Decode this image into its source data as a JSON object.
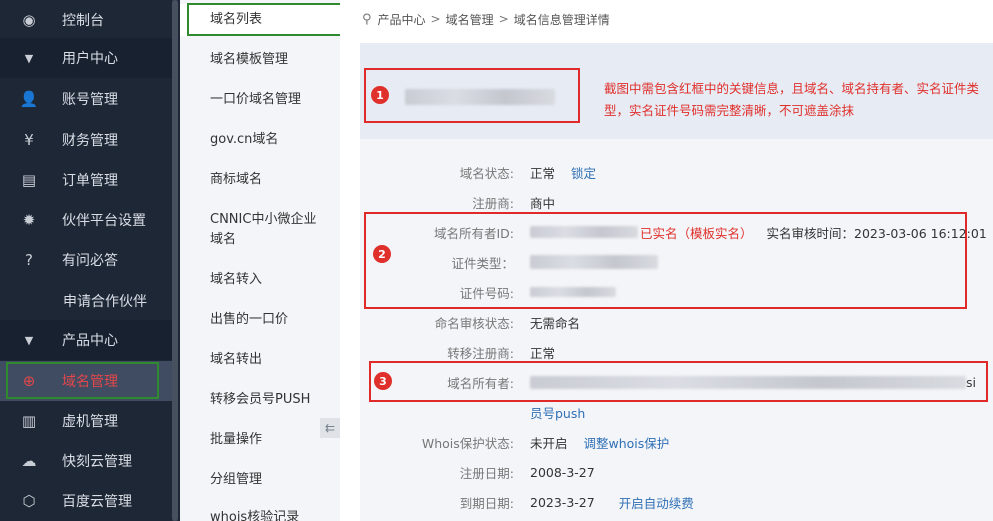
{
  "sidebar": {
    "items": [
      {
        "icon": "dashboard-icon",
        "glyph": "◉",
        "label": "控制台"
      },
      {
        "icon": "chevron-down-icon",
        "glyph": "▼",
        "label": "用户中心"
      },
      {
        "icon": "user-icon",
        "glyph": "👤",
        "label": "账号管理"
      },
      {
        "icon": "yen-icon",
        "glyph": "¥",
        "label": "财务管理"
      },
      {
        "icon": "clipboard-icon",
        "glyph": "▤",
        "label": "订单管理"
      },
      {
        "icon": "gear-icon",
        "glyph": "✹",
        "label": "伙伴平台设置"
      },
      {
        "icon": "help-icon",
        "glyph": "?",
        "label": "有问必答"
      },
      {
        "icon": "",
        "glyph": "",
        "label": "申请合作伙伴"
      },
      {
        "icon": "chevron-down-icon",
        "glyph": "▼",
        "label": "产品中心"
      },
      {
        "icon": "globe-icon",
        "glyph": "⊕",
        "label": "域名管理"
      },
      {
        "icon": "server-icon",
        "glyph": "▥",
        "label": "虚机管理"
      },
      {
        "icon": "cloud-icon",
        "glyph": "☁",
        "label": "快刻云管理"
      },
      {
        "icon": "cube-icon",
        "glyph": "⬡",
        "label": "百度云管理"
      }
    ]
  },
  "subnav": {
    "items": [
      "域名列表",
      "域名模板管理",
      "一口价域名管理",
      "gov.cn域名",
      "商标域名",
      "CNNIC中小微企业域名",
      "域名转入",
      "出售的一口价",
      "域名转出",
      "转移会员号PUSH",
      "批量操作",
      "分组管理",
      "whois核验记录"
    ],
    "collapse_glyph": "⇇"
  },
  "breadcrumb": {
    "part1": "产品中心",
    "sep": ">",
    "part2": "域名管理",
    "part3": "域名信息管理详情"
  },
  "note": "截图中需包含红框中的关键信息，且域名、域名持有者、实名证件类型，实名证件号码需完整清晰，不可遮盖涂抹",
  "badges": [
    "1",
    "2",
    "3"
  ],
  "fields": {
    "status_label": "域名状态:",
    "status_value": "正常",
    "status_link": "锁定",
    "registrar_label": "注册商:",
    "registrar_value": "商中",
    "owner_id_label": "域名所有者ID:",
    "owner_id_tag": "已实名（模板实名）",
    "review_time": "实名审核时间：2023-03-06 16:12:01",
    "cert_type_label": "证件类型：",
    "cert_no_label": "证件号码:",
    "naming_label": "命名审核状态:",
    "naming_value": "无需命名",
    "transfer_label": "转移注册商:",
    "transfer_value": "正常",
    "owner_label": "域名所有者:",
    "owner_tail": "si",
    "owner_link": "员号push",
    "whois_label": "Whois保护状态:",
    "whois_value": "未开启",
    "whois_link": "调整whois保护",
    "reg_date_label": "注册日期:",
    "reg_date_value": "2008-3-27",
    "exp_date_label": "到期日期:",
    "exp_date_value": "2023-3-27",
    "exp_link": "开启自动续费"
  }
}
